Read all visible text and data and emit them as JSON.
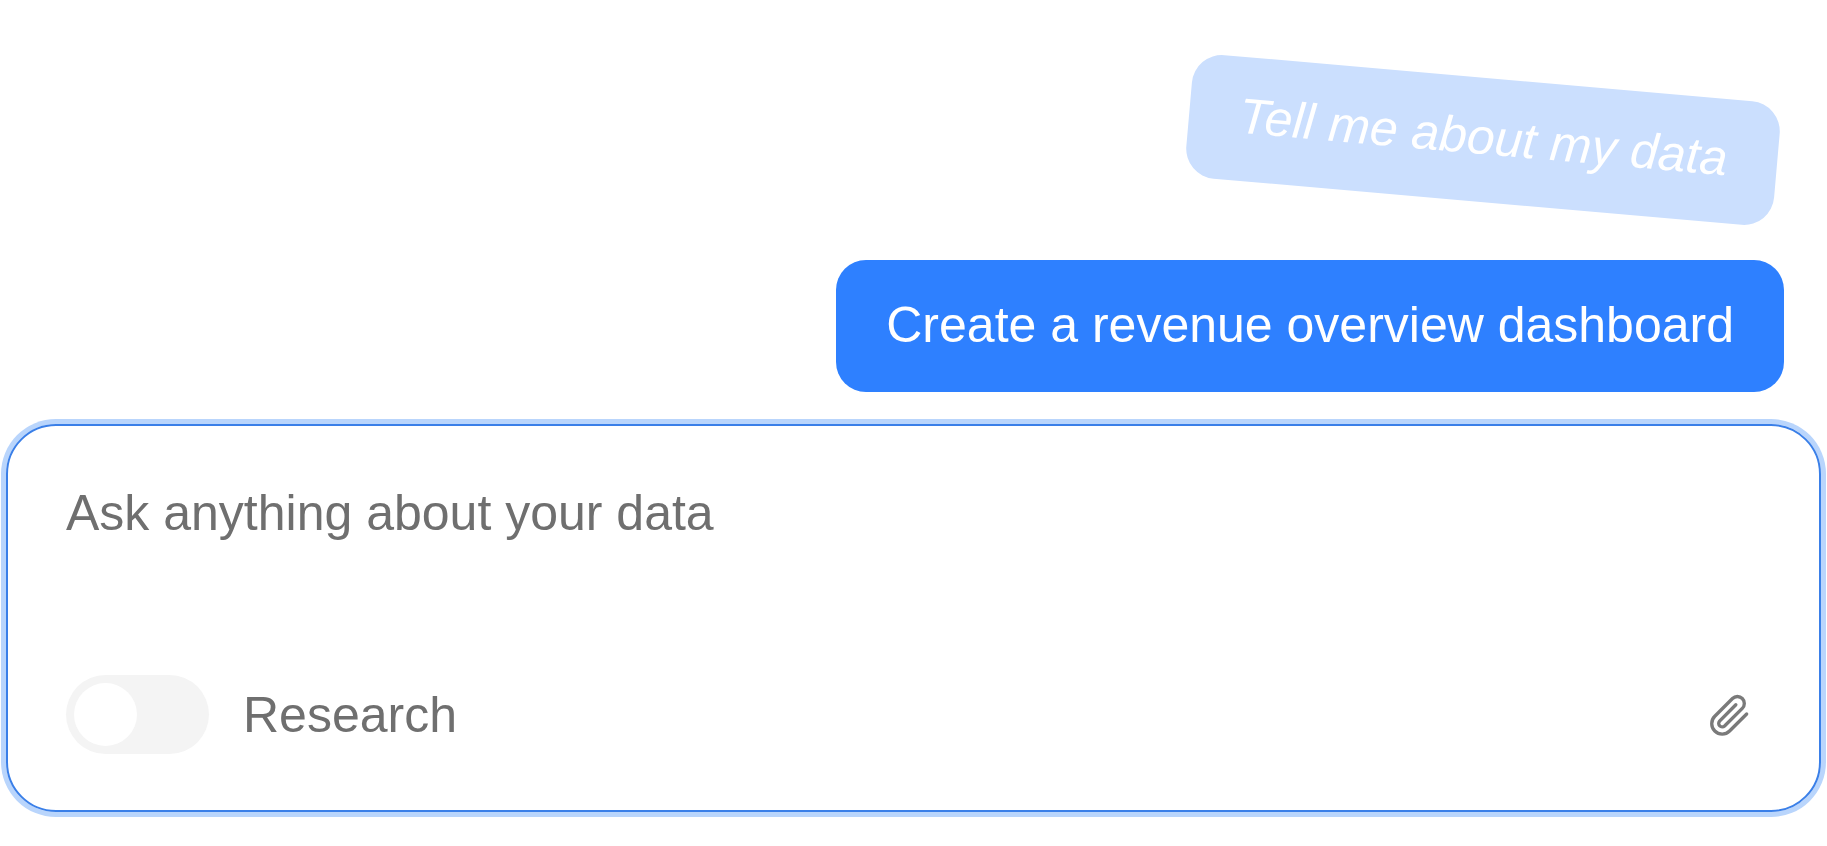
{
  "messages": [
    {
      "kind": "floating",
      "text": "Tell me about my data"
    },
    {
      "kind": "sent",
      "text": "Create a revenue overview dashboard"
    }
  ],
  "composer": {
    "placeholder": "Ask anything about your data",
    "research_toggle": {
      "label": "Research",
      "on": false
    }
  }
}
